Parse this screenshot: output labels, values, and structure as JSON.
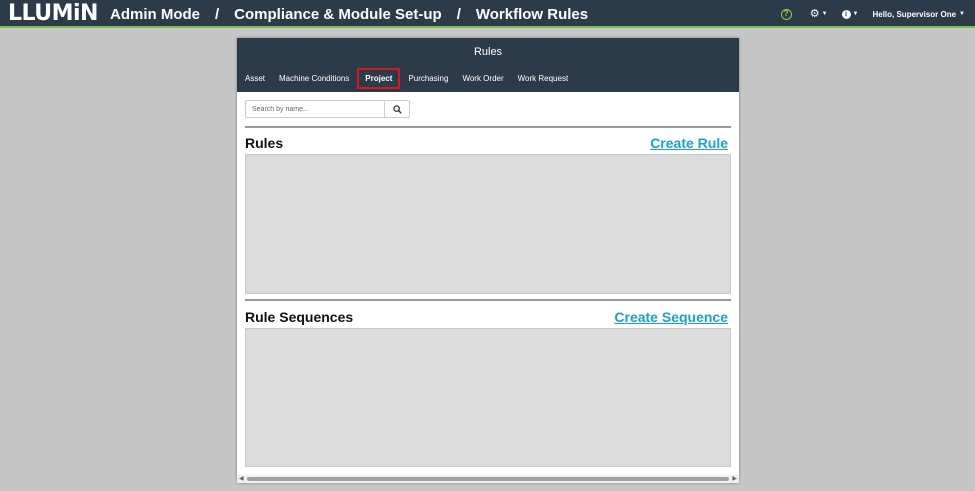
{
  "brand": {
    "logo": "LLUMiN"
  },
  "breadcrumb": [
    "Admin Mode",
    "Compliance & Module Set-up",
    "Workflow Rules"
  ],
  "breadcrumb_separator": "/",
  "header_right": {
    "help_icon": "question-circle-icon",
    "settings_icon": "gear-icon",
    "info_icon": "info-icon",
    "user_greeting": "Hello, Supervisor One"
  },
  "panel": {
    "title": "Rules",
    "tabs": [
      {
        "label": "Asset",
        "active": false
      },
      {
        "label": "Machine Conditions",
        "active": false
      },
      {
        "label": "Project",
        "active": true
      },
      {
        "label": "Purchasing",
        "active": false
      },
      {
        "label": "Work Order",
        "active": false
      },
      {
        "label": "Work Request",
        "active": false
      }
    ],
    "search": {
      "placeholder": "Search by name...",
      "value": ""
    },
    "rules_section": {
      "title": "Rules",
      "link": "Create Rule"
    },
    "sequences_section": {
      "title": "Rule Sequences",
      "link": "Create Sequence"
    }
  },
  "colors": {
    "header_bg": "#2c3b4a",
    "accent_green": "#7cc04b",
    "link_blue": "#1aa3c9",
    "active_tab_outline": "#d8181f"
  }
}
